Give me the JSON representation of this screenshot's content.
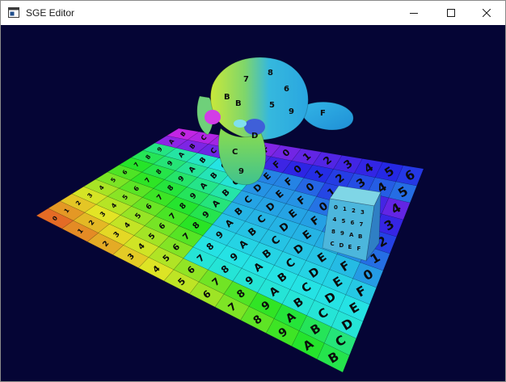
{
  "window": {
    "title": "SGE Editor",
    "icon": "app-window-icon",
    "buttons": {
      "minimize": "minimize-icon",
      "maximize": "maximize-icon",
      "close": "close-icon"
    }
  },
  "viewport": {
    "background_color": "#050535",
    "plane_grid": {
      "rows": 12,
      "cols": 12
    },
    "glyph_pattern": [
      "0",
      "1",
      "2",
      "3",
      "4",
      "5",
      "6",
      "7",
      "8",
      "9",
      "A",
      "B",
      "C",
      "D",
      "E",
      "F"
    ],
    "objects": [
      "textured-floor-plane",
      "suzanne-monkey-head",
      "textured-cube"
    ]
  }
}
